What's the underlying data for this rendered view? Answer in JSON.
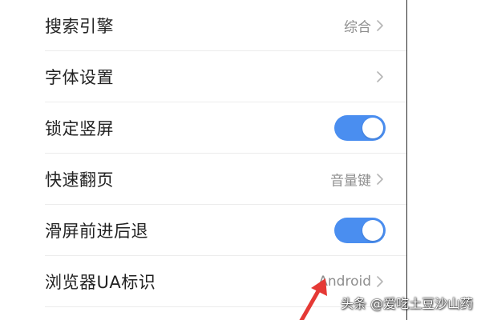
{
  "settings": {
    "items": [
      {
        "label": "搜索引擎",
        "value": "综合",
        "control": "chevron"
      },
      {
        "label": "字体设置",
        "value": "",
        "control": "chevron"
      },
      {
        "label": "锁定竖屏",
        "control": "toggle",
        "state": "on"
      },
      {
        "label": "快速翻页",
        "value": "音量键",
        "control": "chevron"
      },
      {
        "label": "滑屏前进后退",
        "control": "toggle",
        "state": "on"
      },
      {
        "label": "浏览器UA标识",
        "value": "Android",
        "control": "chevron"
      }
    ]
  },
  "colors": {
    "toggle_on": "#4a8ef0",
    "annotation_arrow": "#e53935",
    "label_text": "#222222",
    "value_text": "#8e8e8e"
  },
  "icons": {
    "chevron": "chevron-right-icon",
    "annotation": "red-arrow-annotation"
  },
  "watermark": {
    "text": "头条 @爱吃土豆沙山药"
  }
}
